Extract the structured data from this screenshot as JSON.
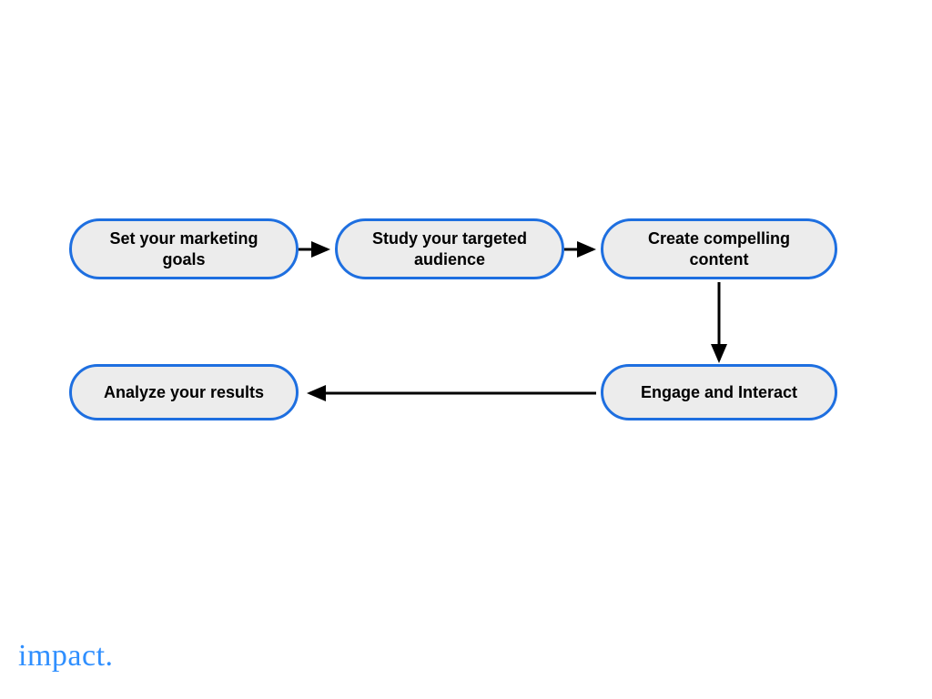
{
  "colors": {
    "node_border": "#1E6FE0",
    "node_fill": "#ECECEC",
    "node_text": "#000000",
    "connector": "#000000",
    "brand": "#2F8FFF"
  },
  "nodes": {
    "n1": {
      "label": "Set your marketing goals"
    },
    "n2": {
      "label": "Study your targeted audience"
    },
    "n3": {
      "label": "Create compelling content"
    },
    "n4": {
      "label": "Engage and Interact"
    },
    "n5": {
      "label": "Analyze your results"
    }
  },
  "flow": [
    {
      "from": "n1",
      "to": "n2"
    },
    {
      "from": "n2",
      "to": "n3"
    },
    {
      "from": "n3",
      "to": "n4"
    },
    {
      "from": "n4",
      "to": "n5"
    }
  ],
  "brand": {
    "text": "impact."
  },
  "chart_data": {
    "type": "flowchart",
    "nodes": [
      {
        "id": "n1",
        "label": "Set your marketing goals"
      },
      {
        "id": "n2",
        "label": "Study your targeted audience"
      },
      {
        "id": "n3",
        "label": "Create compelling content"
      },
      {
        "id": "n4",
        "label": "Engage and Interact"
      },
      {
        "id": "n5",
        "label": "Analyze your results"
      }
    ],
    "edges": [
      {
        "from": "n1",
        "to": "n2"
      },
      {
        "from": "n2",
        "to": "n3"
      },
      {
        "from": "n3",
        "to": "n4"
      },
      {
        "from": "n4",
        "to": "n5"
      }
    ]
  }
}
